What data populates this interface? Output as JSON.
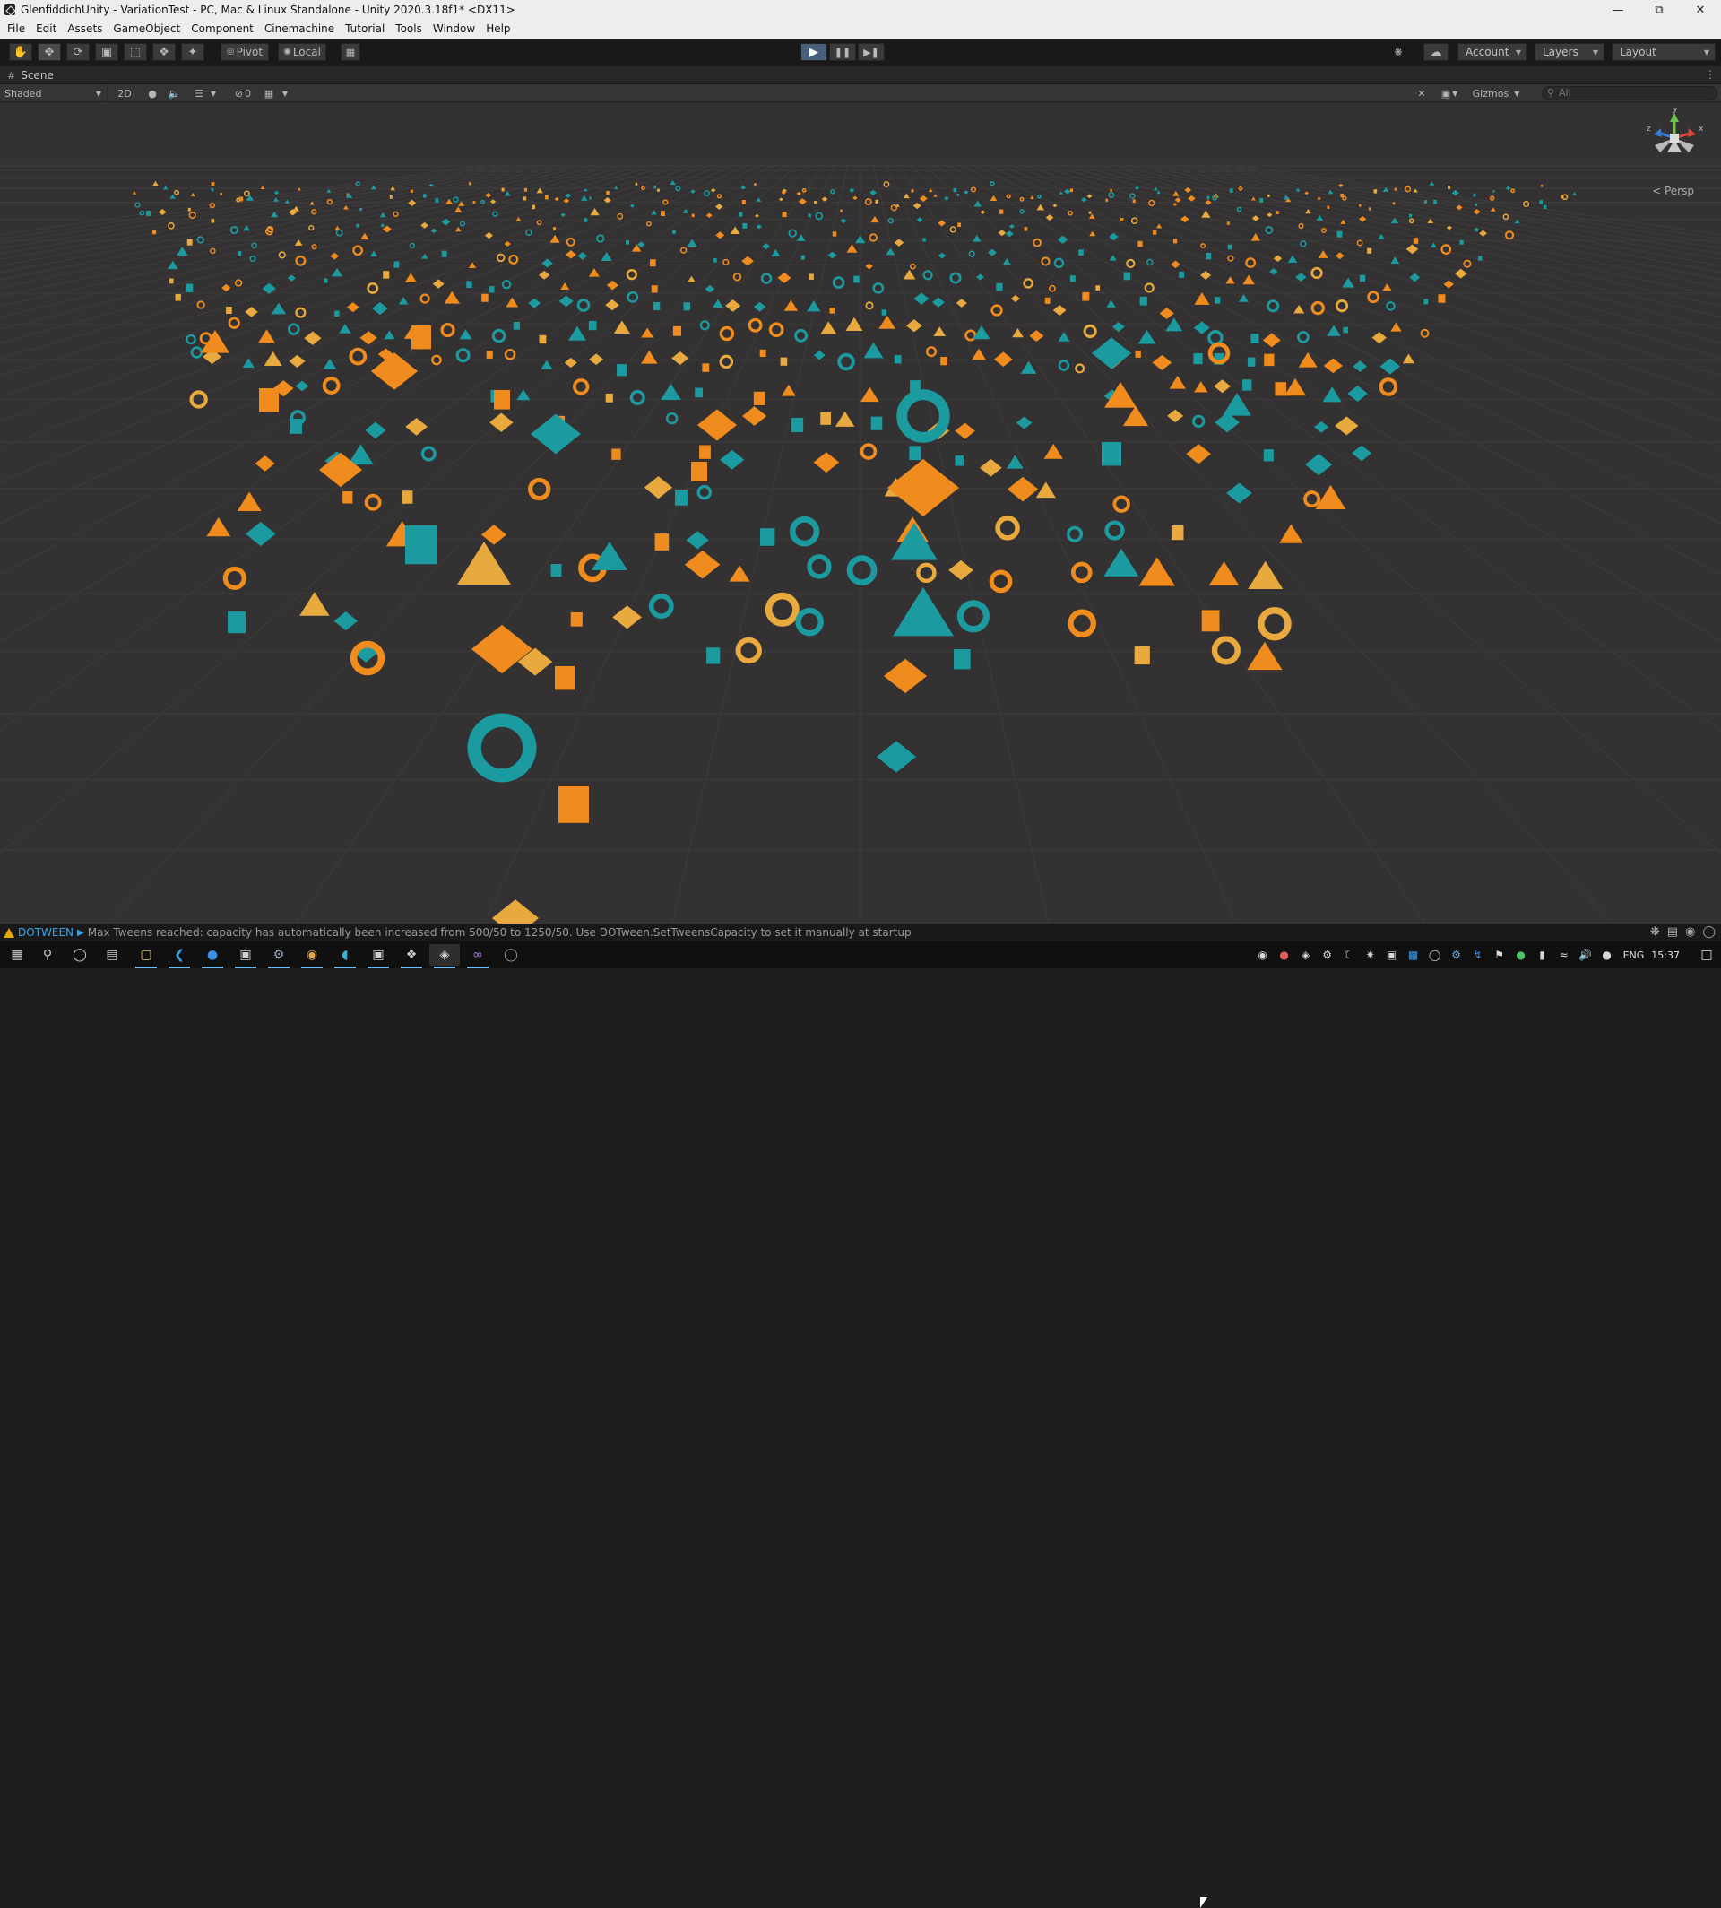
{
  "window": {
    "title": "GlenfiddichUnity - VariationTest - PC, Mac & Linux Standalone - Unity 2020.3.18f1* <DX11>",
    "controls": [
      "minimize-icon",
      "restore-icon",
      "close-icon"
    ]
  },
  "menu": [
    "File",
    "Edit",
    "Assets",
    "GameObject",
    "Component",
    "Cinemachine",
    "Tutorial",
    "Tools",
    "Window",
    "Help"
  ],
  "toolbar": {
    "transform_tools": [
      "hand-icon",
      "move-icon",
      "rotate-icon",
      "scale-icon",
      "rect-icon",
      "transform-icon",
      "custom-tool-icon"
    ],
    "pivot_label": "Pivot",
    "local_label": "Local",
    "account_label": "Account",
    "layers_label": "Layers",
    "layout_label": "Layout"
  },
  "scene_tab": {
    "label": "Scene",
    "shading_mode": "Shaded",
    "toggle_2d": "2D",
    "hidden_count": "0",
    "gizmos_label": "Gizmos",
    "search_placeholder": "All"
  },
  "viewport": {
    "projection_label": "< Persp",
    "gizmo_axes": {
      "x": "x",
      "y": "y",
      "z": "z"
    },
    "colors": {
      "background": "#333131",
      "teal": "#1b9aa0",
      "orange": "#f08c1e",
      "gold": "#e8a93e",
      "grid": "#3d3b3b"
    }
  },
  "console": {
    "tag": "DOTWEEN",
    "message": "Max Tweens reached: capacity has automatically been increased from 500/50 to 1250/50. Use DOTween.SetTweensCapacity to set it manually at startup",
    "level_color": "#e0a800"
  },
  "taskbar": {
    "apps": [
      "windows-start-icon",
      "search-icon",
      "cortana-icon",
      "task-view-icon",
      "file-explorer-icon",
      "vscode-icon",
      "app-blue-icon",
      "app-ue-icon",
      "steam-icon",
      "chrome-icon",
      "edge-icon",
      "app-gray-icon",
      "unity-hub-icon",
      "unity-icon",
      "visual-studio-icon",
      "app-circle-icon"
    ],
    "language": "ENG",
    "clock": "15:37"
  }
}
